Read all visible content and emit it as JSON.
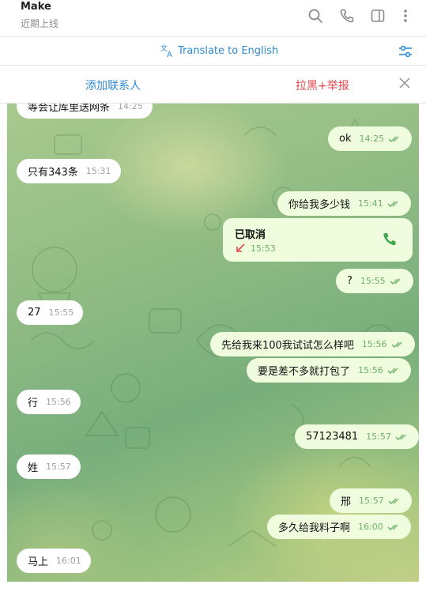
{
  "header": {
    "title": "Make",
    "status": "近期上线",
    "icons": [
      "search-icon",
      "phone-icon",
      "sidebar-toggle-icon",
      "more-vert-icon"
    ]
  },
  "translate_bar": {
    "label": "Translate to English",
    "icon": "translate-icon",
    "settings_icon": "sliders-icon"
  },
  "action_bar": {
    "add_contact": "添加联系人",
    "block_report": "拉黑+举报",
    "close_icon": "close-icon"
  },
  "messages": [
    {
      "dir": "in",
      "text": "等会让库里送网条",
      "time": "14:25"
    },
    {
      "dir": "out",
      "text": "ok",
      "time": "14:25",
      "read": true
    },
    {
      "dir": "in",
      "text": "只有343条",
      "time": "15:31"
    },
    {
      "dir": "out",
      "text": "你给我多少钱",
      "time": "15:41",
      "read": true
    },
    {
      "dir": "out",
      "type": "call",
      "text": "已取消",
      "time": "15:53"
    },
    {
      "dir": "out",
      "text": "?",
      "time": "15:55",
      "read": true
    },
    {
      "dir": "in",
      "text": "27",
      "time": "15:55"
    },
    {
      "dir": "out",
      "text": "先给我来100我试试怎么样吧",
      "time": "15:56",
      "read": true
    },
    {
      "dir": "out",
      "text": "要是差不多就打包了",
      "time": "15:56",
      "read": true
    },
    {
      "dir": "in",
      "text": "行",
      "time": "15:56"
    },
    {
      "dir": "out",
      "text": "57123481",
      "time": "15:57",
      "read": true
    },
    {
      "dir": "in",
      "text": "姓",
      "time": "15:57"
    },
    {
      "dir": "out",
      "text": "邢",
      "time": "15:57",
      "read": true
    },
    {
      "dir": "out",
      "text": "多久给我料子啊",
      "time": "16:00",
      "read": true
    },
    {
      "dir": "in",
      "text": "马上",
      "time": "16:01"
    }
  ],
  "colors": {
    "accent": "#2f8ad1",
    "danger": "#e0454d",
    "outgoing_bubble": "#effdde",
    "incoming_bubble": "#ffffff",
    "read_check": "#6fb06a",
    "call_icon": "#3ea84e",
    "missed_arrow": "#e0454d"
  }
}
